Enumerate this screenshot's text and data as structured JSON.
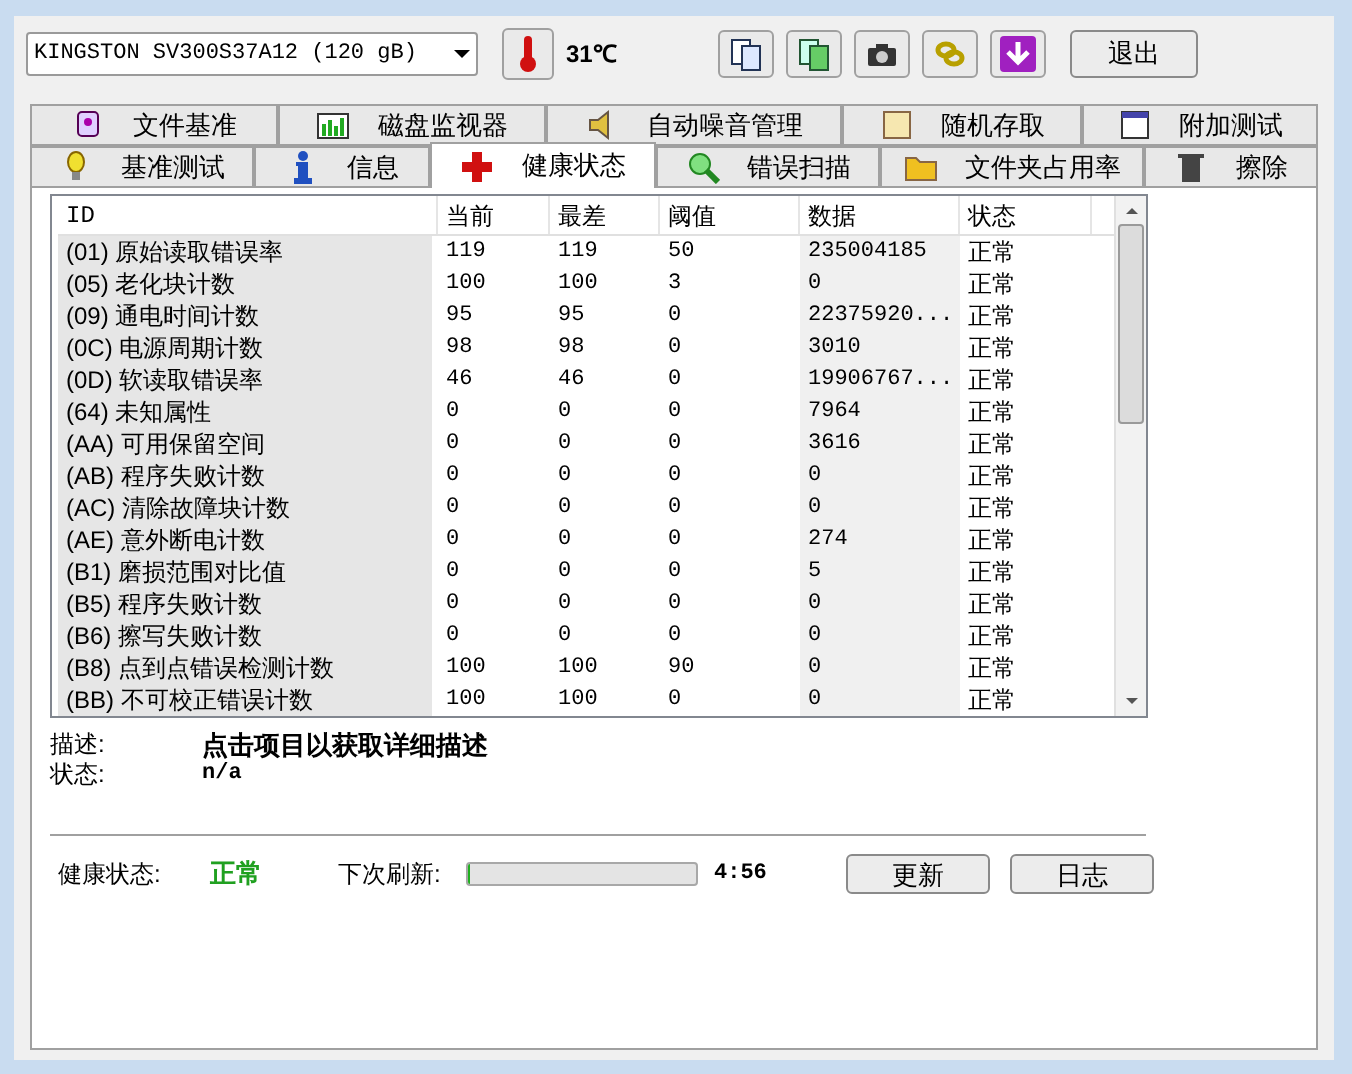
{
  "toolbar": {
    "drive": "KINGSTON SV300S37A12 (120 gB)",
    "temperature": "31℃",
    "exit": "退出"
  },
  "tabs_row_1": [
    {
      "label": "文件基准",
      "selected": false
    },
    {
      "label": "磁盘监视器",
      "selected": false
    },
    {
      "label": "自动噪音管理",
      "selected": false
    },
    {
      "label": "随机存取",
      "selected": false
    },
    {
      "label": "附加测试",
      "selected": false
    }
  ],
  "tabs_row_2": [
    {
      "label": "基准测试",
      "selected": false
    },
    {
      "label": "信息",
      "selected": false
    },
    {
      "label": "健康状态",
      "selected": true
    },
    {
      "label": "错误扫描",
      "selected": false
    },
    {
      "label": "文件夹占用率",
      "selected": false
    },
    {
      "label": "擦除",
      "selected": false
    }
  ],
  "table": {
    "columns": [
      "ID",
      "当前",
      "最差",
      "阈值",
      "数据",
      "状态"
    ],
    "rows": [
      [
        "(01) 原始读取错误率",
        "119",
        "119",
        "50",
        "235004185",
        "正常"
      ],
      [
        "(05) 老化块计数",
        "100",
        "100",
        "3",
        "0",
        "正常"
      ],
      [
        "(09) 通电时间计数",
        "95",
        "95",
        "0",
        "22375920...",
        "正常"
      ],
      [
        "(0C) 电源周期计数",
        "98",
        "98",
        "0",
        "3010",
        "正常"
      ],
      [
        "(0D) 软读取错误率",
        "46",
        "46",
        "0",
        "19906767...",
        "正常"
      ],
      [
        "(64) 未知属性",
        "0",
        "0",
        "0",
        "7964",
        "正常"
      ],
      [
        "(AA) 可用保留空间",
        "0",
        "0",
        "0",
        "3616",
        "正常"
      ],
      [
        "(AB) 程序失败计数",
        "0",
        "0",
        "0",
        "0",
        "正常"
      ],
      [
        "(AC) 清除故障块计数",
        "0",
        "0",
        "0",
        "0",
        "正常"
      ],
      [
        "(AE) 意外断电计数",
        "0",
        "0",
        "0",
        "274",
        "正常"
      ],
      [
        "(B1) 磨损范围对比值",
        "0",
        "0",
        "0",
        "5",
        "正常"
      ],
      [
        "(B5) 程序失败计数",
        "0",
        "0",
        "0",
        "0",
        "正常"
      ],
      [
        "(B6) 擦写失败计数",
        "0",
        "0",
        "0",
        "0",
        "正常"
      ],
      [
        "(B8) 点到点错误检测计数",
        "100",
        "100",
        "90",
        "0",
        "正常"
      ],
      [
        "(BB) 不可校正错误计数",
        "100",
        "100",
        "0",
        "0",
        "正常"
      ]
    ]
  },
  "details": {
    "description_label": "描述:",
    "description": "点击项目以获取详细描述",
    "status_label": "状态:",
    "status": "n/a"
  },
  "footer": {
    "health_label": "健康状态:",
    "health": "正常",
    "refresh_label": "下次刷新:",
    "refresh": {
      "level": 0.01
    },
    "countdown": "4:56",
    "update_button": "更新",
    "log_button": "日志"
  }
}
